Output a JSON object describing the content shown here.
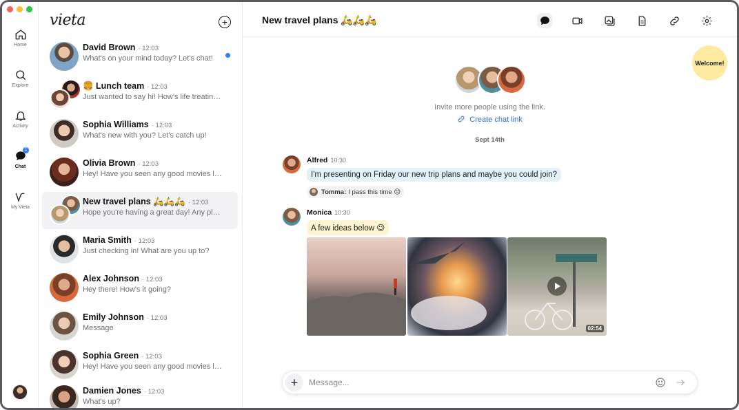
{
  "rail": {
    "items": [
      {
        "label": "Home"
      },
      {
        "label": "Explore"
      },
      {
        "label": "Activity"
      },
      {
        "label": "Chat",
        "badge": "1"
      },
      {
        "label": "My Vieta"
      }
    ]
  },
  "list": {
    "logo": "vieta",
    "conversations": [
      {
        "name": "David Brown",
        "time": "12:03",
        "preview": "What's on your mind today? Let's chat!"
      },
      {
        "name": "🍔 Lunch team",
        "time": "12:03",
        "preview": "Just wanted to say hi! How's life treating you?"
      },
      {
        "name": "Sophia Williams",
        "time": "12:03",
        "preview": "What's new with you? Let's catch up!"
      },
      {
        "name": "Olivia Brown",
        "time": "12:03",
        "preview": "Hey! Have you seen any good movies lately?"
      },
      {
        "name": "New travel plans 🛵🛵🛵",
        "time": "12:03",
        "preview": "Hope you're having a great day! Any plans?"
      },
      {
        "name": "Maria Smith",
        "time": "12:03",
        "preview": "Just checking in! What are you up to?"
      },
      {
        "name": "Alex Johnson",
        "time": "12:03",
        "preview": "Hey there! How's it going?"
      },
      {
        "name": "Emily Johnson",
        "time": "12:03",
        "preview": "Message"
      },
      {
        "name": "Sophia Green",
        "time": "12:03",
        "preview": "Hey! Have you seen any good movies lately?"
      },
      {
        "name": "Damien Jones",
        "time": "12:03",
        "preview": "What's up?"
      }
    ]
  },
  "chat": {
    "title": "New travel plans 🛵🛵🛵",
    "welcome": "Welcome!",
    "invite_text": "Invite more people using the link.",
    "create_link": "Create chat link",
    "date": "Sept 14th",
    "messages": [
      {
        "author": "Alfred",
        "time": "10:30",
        "text": "I'm presenting on Friday our new trip plans and maybe you could join?",
        "reply_author": "Tomma:",
        "reply_text": "I pass this time 😔"
      },
      {
        "author": "Monica",
        "time": "10:30",
        "text": "A few ideas below 😉",
        "video_duration": "02:54"
      }
    ],
    "composer_placeholder": "Message..."
  },
  "colors": {
    "accent": "#2f7cf6",
    "link": "#2f6fd6",
    "bubble_blue": "#e5f0fd",
    "bubble_yellow": "#fdf4d2",
    "welcome": "#fde9a0"
  }
}
